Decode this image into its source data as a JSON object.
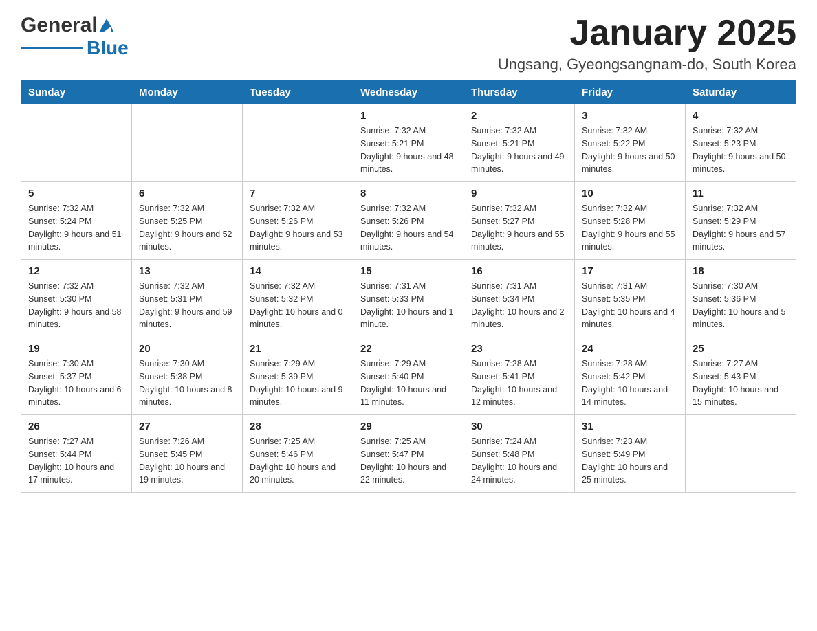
{
  "header": {
    "logo_general": "General",
    "logo_blue": "Blue",
    "month_title": "January 2025",
    "location": "Ungsang, Gyeongsangnam-do, South Korea"
  },
  "weekdays": [
    "Sunday",
    "Monday",
    "Tuesday",
    "Wednesday",
    "Thursday",
    "Friday",
    "Saturday"
  ],
  "weeks": [
    [
      {
        "day": "",
        "sunrise": "",
        "sunset": "",
        "daylight": ""
      },
      {
        "day": "",
        "sunrise": "",
        "sunset": "",
        "daylight": ""
      },
      {
        "day": "",
        "sunrise": "",
        "sunset": "",
        "daylight": ""
      },
      {
        "day": "1",
        "sunrise": "Sunrise: 7:32 AM",
        "sunset": "Sunset: 5:21 PM",
        "daylight": "Daylight: 9 hours and 48 minutes."
      },
      {
        "day": "2",
        "sunrise": "Sunrise: 7:32 AM",
        "sunset": "Sunset: 5:21 PM",
        "daylight": "Daylight: 9 hours and 49 minutes."
      },
      {
        "day": "3",
        "sunrise": "Sunrise: 7:32 AM",
        "sunset": "Sunset: 5:22 PM",
        "daylight": "Daylight: 9 hours and 50 minutes."
      },
      {
        "day": "4",
        "sunrise": "Sunrise: 7:32 AM",
        "sunset": "Sunset: 5:23 PM",
        "daylight": "Daylight: 9 hours and 50 minutes."
      }
    ],
    [
      {
        "day": "5",
        "sunrise": "Sunrise: 7:32 AM",
        "sunset": "Sunset: 5:24 PM",
        "daylight": "Daylight: 9 hours and 51 minutes."
      },
      {
        "day": "6",
        "sunrise": "Sunrise: 7:32 AM",
        "sunset": "Sunset: 5:25 PM",
        "daylight": "Daylight: 9 hours and 52 minutes."
      },
      {
        "day": "7",
        "sunrise": "Sunrise: 7:32 AM",
        "sunset": "Sunset: 5:26 PM",
        "daylight": "Daylight: 9 hours and 53 minutes."
      },
      {
        "day": "8",
        "sunrise": "Sunrise: 7:32 AM",
        "sunset": "Sunset: 5:26 PM",
        "daylight": "Daylight: 9 hours and 54 minutes."
      },
      {
        "day": "9",
        "sunrise": "Sunrise: 7:32 AM",
        "sunset": "Sunset: 5:27 PM",
        "daylight": "Daylight: 9 hours and 55 minutes."
      },
      {
        "day": "10",
        "sunrise": "Sunrise: 7:32 AM",
        "sunset": "Sunset: 5:28 PM",
        "daylight": "Daylight: 9 hours and 55 minutes."
      },
      {
        "day": "11",
        "sunrise": "Sunrise: 7:32 AM",
        "sunset": "Sunset: 5:29 PM",
        "daylight": "Daylight: 9 hours and 57 minutes."
      }
    ],
    [
      {
        "day": "12",
        "sunrise": "Sunrise: 7:32 AM",
        "sunset": "Sunset: 5:30 PM",
        "daylight": "Daylight: 9 hours and 58 minutes."
      },
      {
        "day": "13",
        "sunrise": "Sunrise: 7:32 AM",
        "sunset": "Sunset: 5:31 PM",
        "daylight": "Daylight: 9 hours and 59 minutes."
      },
      {
        "day": "14",
        "sunrise": "Sunrise: 7:32 AM",
        "sunset": "Sunset: 5:32 PM",
        "daylight": "Daylight: 10 hours and 0 minutes."
      },
      {
        "day": "15",
        "sunrise": "Sunrise: 7:31 AM",
        "sunset": "Sunset: 5:33 PM",
        "daylight": "Daylight: 10 hours and 1 minute."
      },
      {
        "day": "16",
        "sunrise": "Sunrise: 7:31 AM",
        "sunset": "Sunset: 5:34 PM",
        "daylight": "Daylight: 10 hours and 2 minutes."
      },
      {
        "day": "17",
        "sunrise": "Sunrise: 7:31 AM",
        "sunset": "Sunset: 5:35 PM",
        "daylight": "Daylight: 10 hours and 4 minutes."
      },
      {
        "day": "18",
        "sunrise": "Sunrise: 7:30 AM",
        "sunset": "Sunset: 5:36 PM",
        "daylight": "Daylight: 10 hours and 5 minutes."
      }
    ],
    [
      {
        "day": "19",
        "sunrise": "Sunrise: 7:30 AM",
        "sunset": "Sunset: 5:37 PM",
        "daylight": "Daylight: 10 hours and 6 minutes."
      },
      {
        "day": "20",
        "sunrise": "Sunrise: 7:30 AM",
        "sunset": "Sunset: 5:38 PM",
        "daylight": "Daylight: 10 hours and 8 minutes."
      },
      {
        "day": "21",
        "sunrise": "Sunrise: 7:29 AM",
        "sunset": "Sunset: 5:39 PM",
        "daylight": "Daylight: 10 hours and 9 minutes."
      },
      {
        "day": "22",
        "sunrise": "Sunrise: 7:29 AM",
        "sunset": "Sunset: 5:40 PM",
        "daylight": "Daylight: 10 hours and 11 minutes."
      },
      {
        "day": "23",
        "sunrise": "Sunrise: 7:28 AM",
        "sunset": "Sunset: 5:41 PM",
        "daylight": "Daylight: 10 hours and 12 minutes."
      },
      {
        "day": "24",
        "sunrise": "Sunrise: 7:28 AM",
        "sunset": "Sunset: 5:42 PM",
        "daylight": "Daylight: 10 hours and 14 minutes."
      },
      {
        "day": "25",
        "sunrise": "Sunrise: 7:27 AM",
        "sunset": "Sunset: 5:43 PM",
        "daylight": "Daylight: 10 hours and 15 minutes."
      }
    ],
    [
      {
        "day": "26",
        "sunrise": "Sunrise: 7:27 AM",
        "sunset": "Sunset: 5:44 PM",
        "daylight": "Daylight: 10 hours and 17 minutes."
      },
      {
        "day": "27",
        "sunrise": "Sunrise: 7:26 AM",
        "sunset": "Sunset: 5:45 PM",
        "daylight": "Daylight: 10 hours and 19 minutes."
      },
      {
        "day": "28",
        "sunrise": "Sunrise: 7:25 AM",
        "sunset": "Sunset: 5:46 PM",
        "daylight": "Daylight: 10 hours and 20 minutes."
      },
      {
        "day": "29",
        "sunrise": "Sunrise: 7:25 AM",
        "sunset": "Sunset: 5:47 PM",
        "daylight": "Daylight: 10 hours and 22 minutes."
      },
      {
        "day": "30",
        "sunrise": "Sunrise: 7:24 AM",
        "sunset": "Sunset: 5:48 PM",
        "daylight": "Daylight: 10 hours and 24 minutes."
      },
      {
        "day": "31",
        "sunrise": "Sunrise: 7:23 AM",
        "sunset": "Sunset: 5:49 PM",
        "daylight": "Daylight: 10 hours and 25 minutes."
      },
      {
        "day": "",
        "sunrise": "",
        "sunset": "",
        "daylight": ""
      }
    ]
  ]
}
